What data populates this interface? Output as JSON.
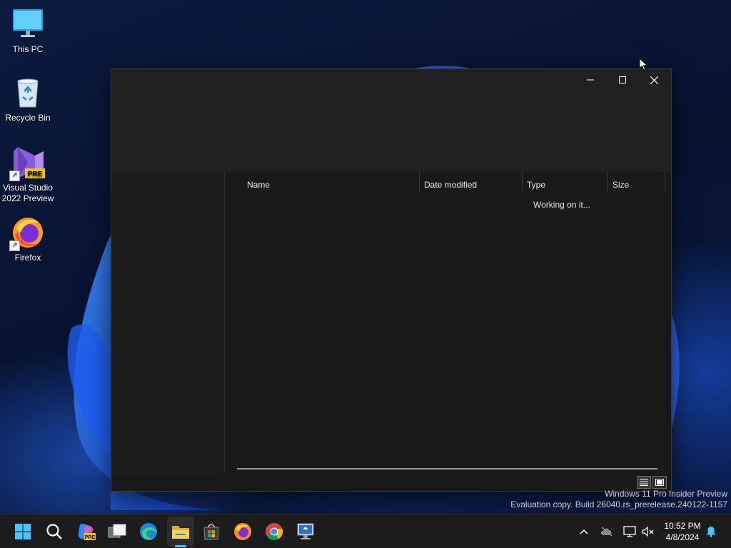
{
  "desktop": {
    "icons": [
      {
        "label": "This PC"
      },
      {
        "label": "Recycle Bin"
      },
      {
        "label": "Visual Studio 2022 Preview",
        "badge": "PRE"
      },
      {
        "label": "Firefox"
      }
    ]
  },
  "explorer": {
    "columns": [
      {
        "label": "Name"
      },
      {
        "label": "Date modified"
      },
      {
        "label": "Type"
      },
      {
        "label": "Size"
      }
    ],
    "status": "Working on it...",
    "controls": {
      "minimize": "minimize-icon",
      "maximize": "maximize-icon",
      "close": "close-icon"
    }
  },
  "watermark": {
    "line1": "Windows 11 Pro Insider Preview",
    "line2": "Evaluation copy. Build 26040.rs_prerelease.240122-1157"
  },
  "taskbar": {
    "apps": [
      "start-icon",
      "search-icon",
      "copilot-icon",
      "task-view-icon",
      "edge-icon",
      "file-explorer-icon",
      "store-icon",
      "firefox-icon",
      "chrome-icon",
      "rdp-icon"
    ],
    "copilot_badge": "PRE",
    "time": "10:52 PM",
    "date": "4/8/2024"
  },
  "colors": {
    "accent": "#4cc2ff",
    "window_bg": "#191919",
    "titlebar_bg": "#202020",
    "taskbar_bg": "#1c1c1c"
  }
}
